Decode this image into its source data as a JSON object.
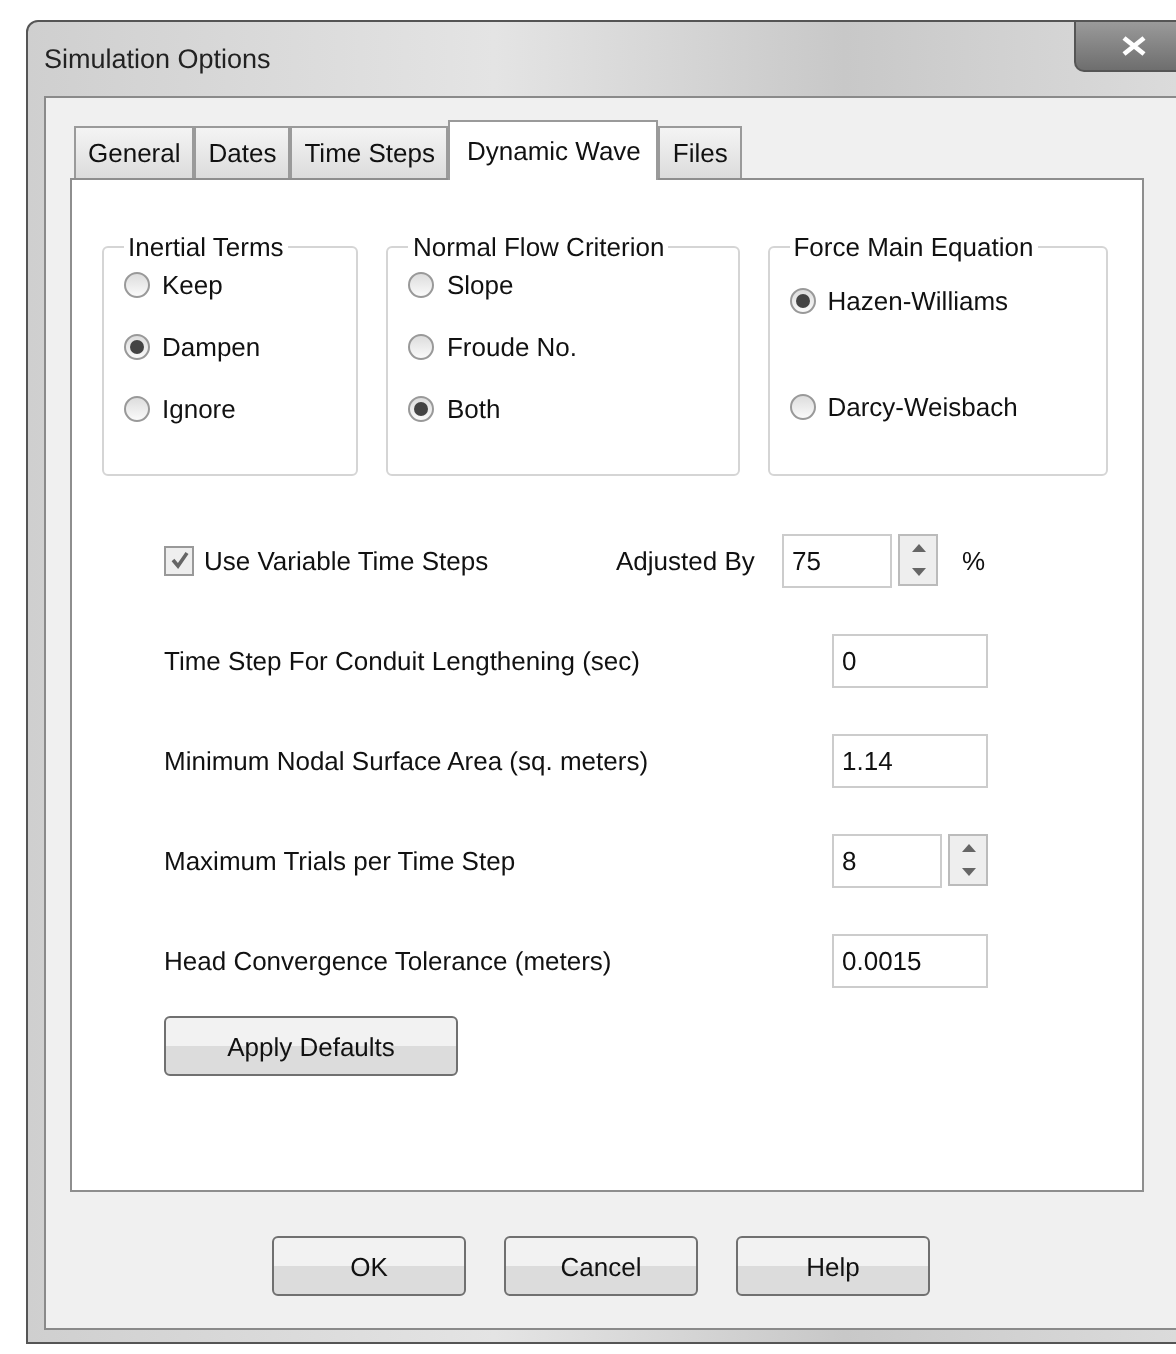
{
  "window": {
    "title": "Simulation Options"
  },
  "tabs": [
    {
      "label": "General",
      "selected": false
    },
    {
      "label": "Dates",
      "selected": false
    },
    {
      "label": "Time Steps",
      "selected": false
    },
    {
      "label": "Dynamic Wave",
      "selected": true
    },
    {
      "label": "Files",
      "selected": false
    }
  ],
  "groups": [
    {
      "title": "Inertial Terms",
      "options": [
        {
          "label": "Keep",
          "selected": false
        },
        {
          "label": "Dampen",
          "selected": true
        },
        {
          "label": "Ignore",
          "selected": false
        }
      ]
    },
    {
      "title": "Normal Flow Criterion",
      "options": [
        {
          "label": "Slope",
          "selected": false
        },
        {
          "label": "Froude No.",
          "selected": false
        },
        {
          "label": "Both",
          "selected": true
        }
      ]
    },
    {
      "title": "Force Main Equation",
      "options": [
        {
          "label": "Hazen-Williams",
          "selected": true
        },
        {
          "label": "Darcy-Weisbach",
          "selected": false
        }
      ]
    }
  ],
  "variable_time_steps": {
    "label": "Use Variable Time Steps",
    "checked": true,
    "adjusted_label": "Adjusted By",
    "value": "75",
    "unit": "%"
  },
  "fields": [
    {
      "label": "Time Step For Conduit Lengthening (sec)",
      "value": "0",
      "kind": "text"
    },
    {
      "label": "Minimum Nodal Surface Area (sq. meters)",
      "value": "1.14",
      "kind": "text"
    },
    {
      "label": "Maximum Trials per Time Step",
      "value": "8",
      "kind": "spinner"
    },
    {
      "label": "Head Convergence Tolerance (meters)",
      "value": "0.0015",
      "kind": "text"
    }
  ],
  "apply_button": "Apply Defaults",
  "buttons": [
    "OK",
    "Cancel",
    "Help"
  ]
}
